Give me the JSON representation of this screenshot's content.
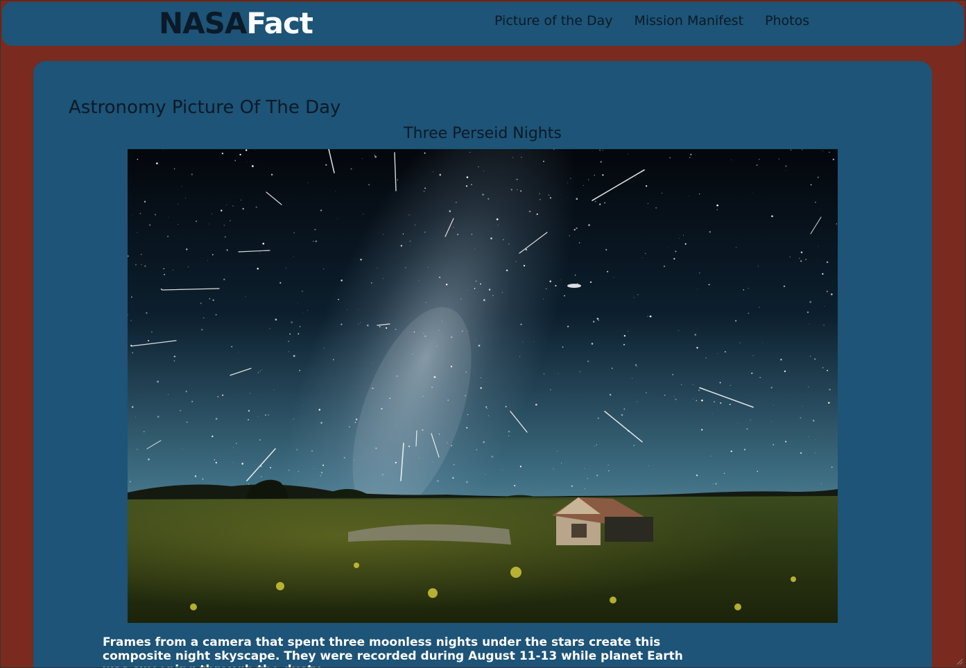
{
  "navbar": {
    "logo_part1": "NASA",
    "logo_part2": "Fact",
    "links": [
      "Picture of the Day",
      "Mission Manifest",
      "Photos"
    ]
  },
  "main": {
    "heading": "Astronomy Picture Of The Day",
    "picture_title": "Three Perseid Nights",
    "description": "Frames from a camera that spent three moonless nights under the stars create this composite night skyscape. They were recorded during August 11-13 while planet Earth was sweeping through the dusty"
  },
  "colors": {
    "page_background": "#7a2a1e",
    "panel_background": "#1d5477",
    "logo_dark": "#0b1a28",
    "logo_light": "#ffffff"
  }
}
